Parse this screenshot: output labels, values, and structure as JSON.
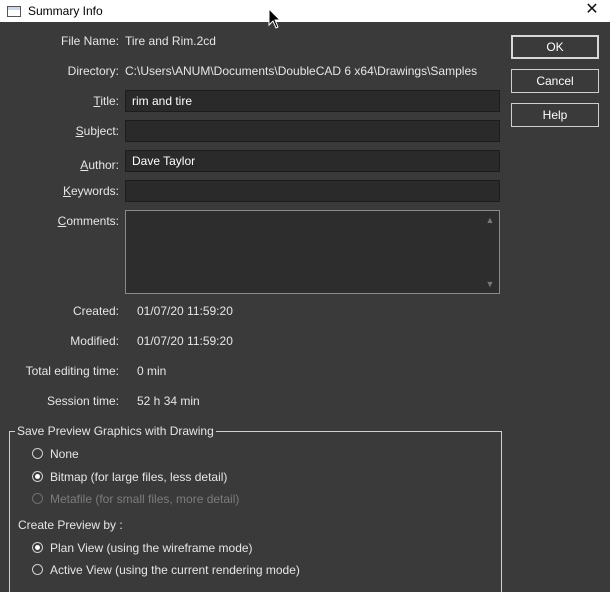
{
  "window": {
    "title": "Summary Info"
  },
  "labels": {
    "file_name": "File Name:",
    "directory": "Directory:",
    "title_pre": "",
    "title_u": "T",
    "title_post": "itle:",
    "subject_pre": "",
    "subject_u": "S",
    "subject_post": "ubject:",
    "author_pre": "",
    "author_u": "A",
    "author_post": "uthor:",
    "keywords_pre": "",
    "keywords_u": "K",
    "keywords_post": "eywords:",
    "comments_pre": "",
    "comments_u": "C",
    "comments_post": "omments:",
    "created": "Created:",
    "modified": "Modified:",
    "total_editing": "Total editing time:",
    "session": "Session time:"
  },
  "values": {
    "file_name": "Tire and Rim.2cd",
    "directory": "C:\\Users\\ANUM\\Documents\\DoubleCAD 6 x64\\Drawings\\Samples",
    "title": "rim and tire",
    "subject": "",
    "author": "Dave Taylor",
    "keywords": "",
    "comments": "",
    "created": "01/07/20  11:59:20",
    "modified": "01/07/20  11:59:20",
    "total_editing": "0 min",
    "session": "52 h 34 min"
  },
  "buttons": {
    "ok": "OK",
    "cancel": "Cancel",
    "help": "Help"
  },
  "preview_group": {
    "title": "Save Preview Graphics with Drawing",
    "options": [
      "None",
      "Bitmap (for large files, less detail)",
      "Metafile (for small files, more detail)"
    ],
    "selected": "Bitmap (for large files, less detail)"
  },
  "create_preview": {
    "label": "Create Preview by :",
    "options": [
      "Plan View (using the wireframe mode)",
      "Active View (using the current rendering mode)"
    ],
    "selected": "Plan View (using the wireframe mode)"
  },
  "icons": {
    "window": "app-window-icon",
    "close": "close-icon",
    "cursor": "mouse-cursor-icon"
  }
}
